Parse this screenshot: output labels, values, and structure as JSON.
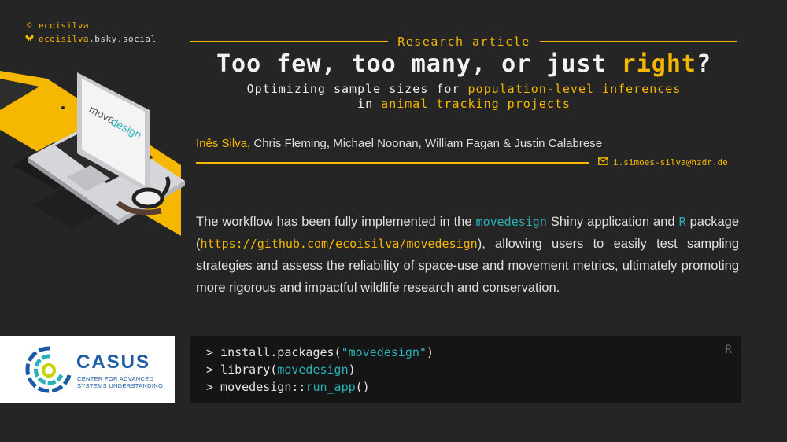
{
  "social": {
    "handle": "ecoisilva",
    "bluesky_prefix": "ecoisilva",
    "bluesky_suffix": ".bsky.social"
  },
  "laptop_screen": {
    "text1": "move",
    "text2": "design"
  },
  "header": {
    "kicker": "Research article",
    "title_part1": "Too few, too many, or just ",
    "title_highlight": "right",
    "title_part2": "?",
    "subtitle_l1_a": "Optimizing sample sizes for ",
    "subtitle_l1_b": "population-level inferences",
    "subtitle_l2_a": "in ",
    "subtitle_l2_b": "animal tracking projects"
  },
  "authors": {
    "first": "Inês Silva,",
    "rest": " Chris Fleming, Michael Noonan, William Fagan & Justin Calabrese",
    "email": "i.simoes-silva@hzdr.de"
  },
  "body": {
    "p1": "The workflow has been fully implemented in the ",
    "pkg": "movedesign",
    "p2": " Shiny application and ",
    "r": "R",
    "p3": " package (",
    "url": "https://github.com/ecoisilva/movedesign",
    "p4": "), allowing users to easily test sampling strategies and assess the reliability of space-use and movement metrics, ultimately promoting more rigorous and impactful wildlife research and conservation."
  },
  "code": {
    "lang": "R",
    "line1_a": "> install.packages(",
    "line1_b": "\"movedesign\"",
    "line1_c": ")",
    "line2_a": "> library(",
    "line2_b": "movedesign",
    "line2_c": ")",
    "line3_a": "> movedesign::",
    "line3_b": "run_app",
    "line3_c": "()"
  },
  "logo": {
    "name": "CASUS",
    "sub1": "CENTER FOR ADVANCED",
    "sub2": "SYSTEMS UNDERSTANDING"
  },
  "colors": {
    "background": "#252525",
    "accent": "#f5b700",
    "teal": "#2bb0b7",
    "code_bg": "#151515",
    "brand_blue": "#1b5aa4"
  }
}
